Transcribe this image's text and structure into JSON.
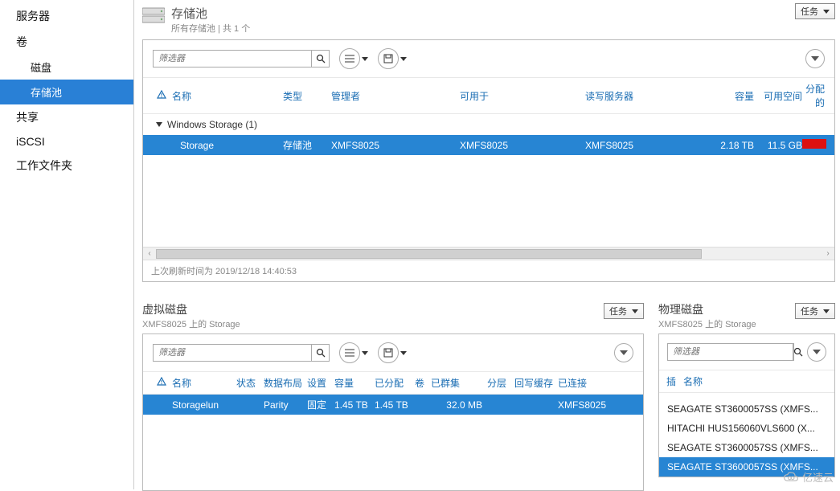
{
  "sidebar": {
    "items": [
      {
        "label": "服务器"
      },
      {
        "label": "卷"
      },
      {
        "label": "磁盘"
      },
      {
        "label": "存储池"
      },
      {
        "label": "共享"
      },
      {
        "label": "iSCSI"
      },
      {
        "label": "工作文件夹"
      }
    ]
  },
  "storage_pool": {
    "title": "存储池",
    "subtitle": "所有存储池 | 共 1 个",
    "tasks_label": "任务",
    "filter_placeholder": "筛选器",
    "columns": {
      "name": "名称",
      "type": "类型",
      "manager": "管理者",
      "available_for": "可用于",
      "rw_server": "读写服务器",
      "capacity": "容量",
      "free_space": "可用空间",
      "alloc": "分配的"
    },
    "group_label": "Windows Storage (1)",
    "row": {
      "name": "Storage",
      "type": "存储池",
      "manager": "XMFS8025",
      "available_for": "XMFS8025",
      "rw_server": "XMFS8025",
      "capacity": "2.18 TB",
      "free_space": "11.5 GB"
    },
    "refresh_text": "上次刷新时间为 2019/12/18 14:40:53"
  },
  "virtual_disk": {
    "title": "虚拟磁盘",
    "subtitle": "XMFS8025 上的 Storage",
    "tasks_label": "任务",
    "filter_placeholder": "筛选器",
    "columns": {
      "name": "名称",
      "status": "状态",
      "layout": "数据布局",
      "setting": "设置",
      "capacity": "容量",
      "allocated": "已分配",
      "volume": "卷",
      "cluster": "已群集",
      "tier": "分层",
      "writeback": "回写缓存",
      "connected": "已连接"
    },
    "row": {
      "name": "Storagelun",
      "status": "",
      "layout": "Parity",
      "setting": "固定",
      "capacity": "1.45 TB",
      "allocated": "1.45 TB",
      "cluster": "32.0 MB",
      "connected": "XMFS8025"
    }
  },
  "physical_disk": {
    "title": "物理磁盘",
    "subtitle": "XMFS8025 上的 Storage",
    "tasks_label": "任务",
    "filter_placeholder": "筛选器",
    "columns": {
      "slot_trunc": "插",
      "name": "名称"
    },
    "rows": [
      {
        "name": "SEAGATE ST3600057SS (XMFS..."
      },
      {
        "name": "HITACHI HUS156060VLS600 (X..."
      },
      {
        "name": "SEAGATE ST3600057SS (XMFS..."
      },
      {
        "name": "SEAGATE ST3600057SS (XMFS..."
      }
    ]
  },
  "watermark": "亿速云"
}
